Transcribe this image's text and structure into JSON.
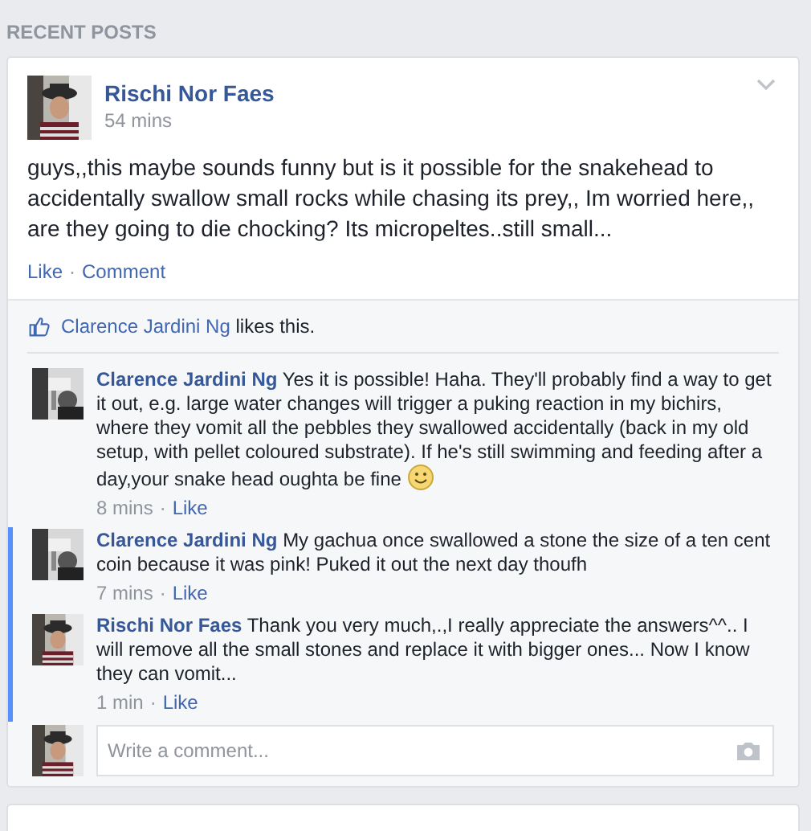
{
  "section_title": "RECENT POSTS",
  "post": {
    "author": "Rischi Nor Faes",
    "time": "54 mins",
    "text": "guys,,this maybe sounds funny but is it possible for the snakehead to accidentally swallow small rocks while chasing its prey,, Im worried here,, are they going to die chocking? Its micropeltes..still small...",
    "actions": [
      "Like",
      "Comment"
    ],
    "separator": "·"
  },
  "likes": {
    "name": "Clarence Jardini Ng",
    "text": "likes this."
  },
  "comments": [
    {
      "author": "Clarence Jardini Ng",
      "kind": "grayscale",
      "text": "Yes it is possible! Haha. They'll probably find a way to get it out, e.g. large water changes will trigger a puking reaction in my bichirs, where they vomit all the pebbles they swallowed accidentally (back in my old setup, with pellet coloured substrate). If he's still swimming and feeding after a day,your snake head oughta be fine",
      "emoji": true,
      "time": "8 mins",
      "action": "Like",
      "separator": "·",
      "highlighted": false
    },
    {
      "author": "Clarence Jardini Ng",
      "kind": "grayscale",
      "text": "My gachua once swallowed a stone the size of a ten cent coin because it was pink! Puked it out the next day thoufh",
      "emoji": false,
      "time": "7 mins",
      "action": "Like",
      "separator": "·",
      "highlighted": true
    },
    {
      "author": "Rischi Nor Faes",
      "kind": "color",
      "text": "Thank you very much,.,I really appreciate the answers^^.. I will remove all the small stones and replace it with bigger ones... Now I know they can vomit...",
      "emoji": false,
      "time": "1 min",
      "action": "Like",
      "separator": "·",
      "highlighted": true
    }
  ],
  "comment_box": {
    "placeholder": "Write a comment..."
  }
}
